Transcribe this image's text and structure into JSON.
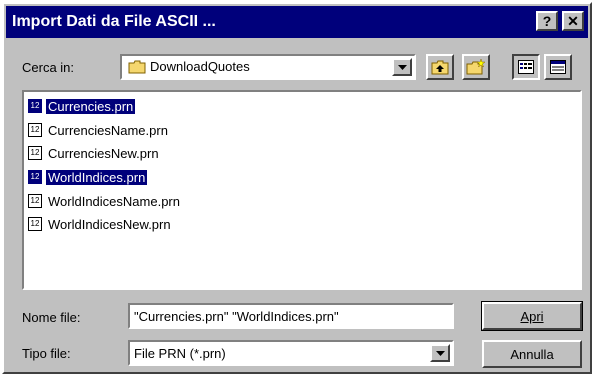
{
  "window": {
    "title": "Import Dati da File ASCII ...",
    "help_glyph": "?",
    "close_glyph": "✕"
  },
  "lookin": {
    "label": "Cerca in:",
    "value": "DownloadQuotes"
  },
  "files": [
    {
      "name": "Currencies.prn",
      "selected": true
    },
    {
      "name": "CurrenciesName.prn",
      "selected": false
    },
    {
      "name": "CurrenciesNew.prn",
      "selected": false
    },
    {
      "name": "WorldIndices.prn",
      "selected": true
    },
    {
      "name": "WorldIndicesName.prn",
      "selected": false
    },
    {
      "name": "WorldIndicesNew.prn",
      "selected": false
    }
  ],
  "filename": {
    "label": "Nome file:",
    "value": "\"Currencies.prn\" \"WorldIndices.prn\""
  },
  "filetype": {
    "label": "Tipo file:",
    "value": "File PRN (*.prn)"
  },
  "buttons": {
    "open": "Apri",
    "cancel": "Annulla"
  },
  "icons": {
    "up_folder": "up-folder-icon",
    "new_folder": "new-folder-icon",
    "list_view": "list-view-icon",
    "details_view": "details-view-icon",
    "file": "prn-file-icon"
  }
}
